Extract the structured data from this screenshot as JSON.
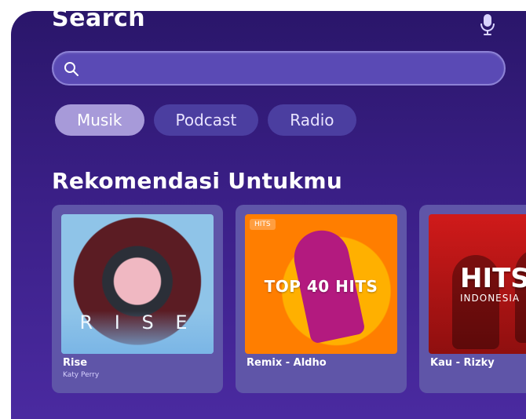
{
  "header": {
    "title": "Search",
    "mic_icon": "microphone-icon"
  },
  "search": {
    "placeholder": "",
    "value": "",
    "icon": "search-icon"
  },
  "filters": [
    {
      "label": "Musik",
      "active": true
    },
    {
      "label": "Podcast",
      "active": false
    },
    {
      "label": "Radio",
      "active": false
    }
  ],
  "section": {
    "title": "Rekomendasi Untukmu"
  },
  "cards": [
    {
      "title": "Rise",
      "subtitle": "Katy Perry",
      "art_text": "R I S E"
    },
    {
      "title": "Remix - Aldho",
      "subtitle": "",
      "art_text": "TOP 40 HITS",
      "art_tag": "HITS"
    },
    {
      "title": "Kau - Rizky",
      "subtitle": "",
      "art_text": "HITS",
      "art_sub": "INDONESIA"
    }
  ],
  "colors": {
    "background_start": "#2a166a",
    "background_end": "#4a2aa0",
    "chip_active": "#a79ad9",
    "chip_inactive": "#4b3ea0",
    "card": "#5f55a8"
  }
}
